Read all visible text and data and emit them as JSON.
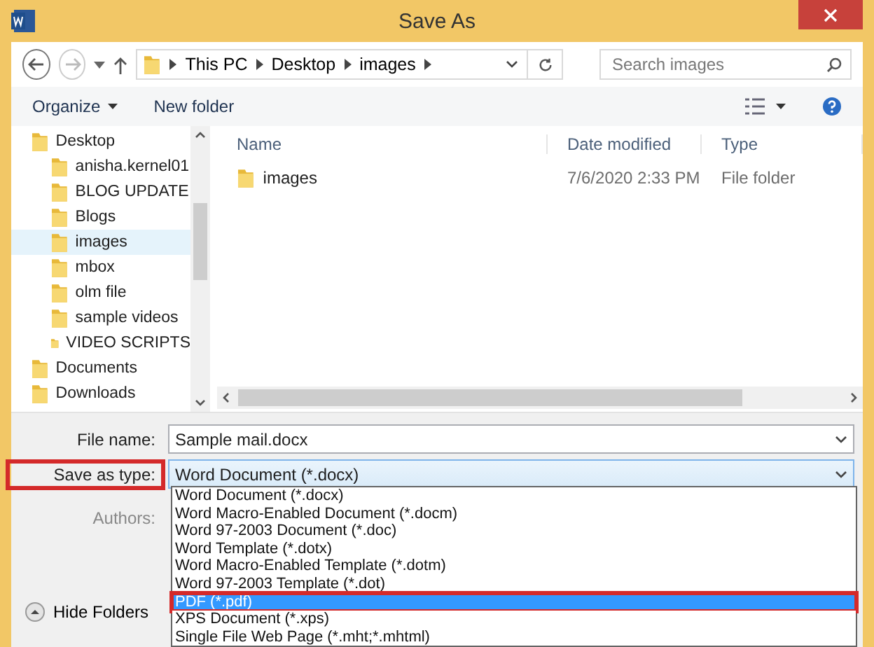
{
  "window": {
    "title": "Save As"
  },
  "nav": {
    "breadcrumb": [
      "This PC",
      "Desktop",
      "images"
    ],
    "search": {
      "placeholder": "Search images"
    }
  },
  "toolbar": {
    "organize": "Organize",
    "new_folder": "New folder"
  },
  "tree": [
    {
      "label": "Desktop",
      "selected": false,
      "children": [
        {
          "label": "anisha.kernel01",
          "selected": false
        },
        {
          "label": "BLOG UPDATE",
          "selected": false
        },
        {
          "label": "Blogs",
          "selected": false
        },
        {
          "label": "images",
          "selected": true
        },
        {
          "label": "mbox",
          "selected": false
        },
        {
          "label": "olm file",
          "selected": false
        },
        {
          "label": "sample videos",
          "selected": false
        },
        {
          "label": "VIDEO SCRIPTS",
          "selected": false
        }
      ]
    },
    {
      "label": "Documents",
      "selected": false
    },
    {
      "label": "Downloads",
      "selected": false
    }
  ],
  "table": {
    "columns": [
      "Name",
      "Date modified",
      "Type"
    ],
    "rows": [
      {
        "name": "images",
        "date": "7/6/2020 2:33 PM",
        "type": "File folder"
      }
    ]
  },
  "form": {
    "file_name": {
      "label": "File name:",
      "value": "Sample mail.docx"
    },
    "save_as_type": {
      "label": "Save as type:",
      "value": "Word Document (*.docx)",
      "highlighted": true
    },
    "authors": {
      "label": "Authors:"
    }
  },
  "dropdown": [
    {
      "label": "Word Document (*.docx)",
      "selected": false,
      "highlighted": false
    },
    {
      "label": "Word Macro-Enabled Document (*.docm)",
      "selected": false,
      "highlighted": false
    },
    {
      "label": "Word 97-2003 Document (*.doc)",
      "selected": false,
      "highlighted": false
    },
    {
      "label": "Word Template (*.dotx)",
      "selected": false,
      "highlighted": false
    },
    {
      "label": "Word Macro-Enabled Template (*.dotm)",
      "selected": false,
      "highlighted": false
    },
    {
      "label": "Word 97-2003 Template (*.dot)",
      "selected": false,
      "highlighted": false
    },
    {
      "label": "PDF (*.pdf)",
      "selected": true,
      "highlighted": true
    },
    {
      "label": "XPS Document (*.xps)",
      "selected": false,
      "highlighted": false
    },
    {
      "label": "Single File Web Page (*.mht;*.mhtml)",
      "selected": false,
      "highlighted": false
    }
  ],
  "hide_folders": "Hide Folders"
}
